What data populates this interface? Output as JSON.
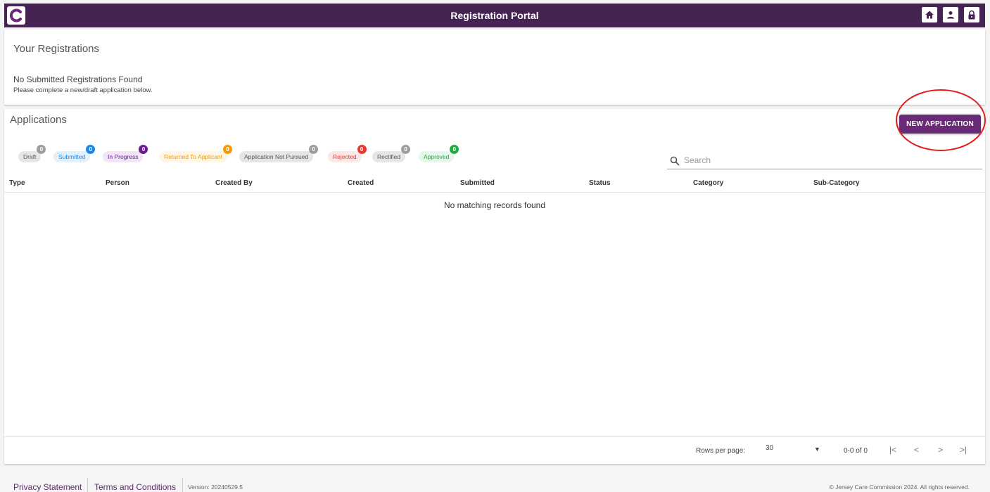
{
  "app": {
    "title": "Registration Portal",
    "brand_color": "#452353",
    "accent_color": "#6b2a78",
    "nav_icons": [
      "home-icon",
      "account-icon",
      "lock-icon"
    ]
  },
  "registrations": {
    "title": "Your Registrations",
    "empty_message": "No Submitted Registrations Found",
    "empty_hint": "Please complete a new/draft application below."
  },
  "applications": {
    "title": "Applications",
    "new_button_label": "NEW APPLICATION",
    "filters": [
      {
        "label": "Draft",
        "count": "0",
        "text_color": "#555555",
        "bg": "#e6e6e6",
        "badge": "#9e9e9e"
      },
      {
        "label": "Submitted",
        "count": "0",
        "text_color": "#1e88e5",
        "bg": "#e3f1fd",
        "badge": "#1e88e5"
      },
      {
        "label": "In Progress",
        "count": "0",
        "text_color": "#6a1b9a",
        "bg": "#f1e6f5",
        "badge": "#6a1b9a"
      },
      {
        "label": "Returned To Applicant",
        "count": "0",
        "text_color": "#f59b00",
        "bg": "#fff6e5",
        "badge": "#f59b00"
      },
      {
        "label": "Application Not Pursued",
        "count": "0",
        "text_color": "#555555",
        "bg": "#e6e6e6",
        "badge": "#9e9e9e"
      },
      {
        "label": "Rejected",
        "count": "0",
        "text_color": "#e53935",
        "bg": "#fde7e7",
        "badge": "#e53935"
      },
      {
        "label": "Rectified",
        "count": "0",
        "text_color": "#555555",
        "bg": "#e6e6e6",
        "badge": "#9e9e9e"
      },
      {
        "label": "Approved",
        "count": "0",
        "text_color": "#1fae3d",
        "bg": "#e6f6ea",
        "badge": "#1fae3d"
      }
    ],
    "search_placeholder": "Search",
    "columns": [
      "Type",
      "Person",
      "Created By",
      "Created",
      "Submitted",
      "Status",
      "Category",
      "Sub-Category"
    ],
    "empty_message": "No matching records found",
    "pagination": {
      "rows_per_page_label": "Rows per page:",
      "rows_per_page": "30",
      "range": "0-0 of 0"
    }
  },
  "footer": {
    "privacy": "Privacy Statement",
    "terms": "Terms and Conditions",
    "version": "Version: 20240529.5",
    "copyright": "© Jersey Care Commission 2024. All rights reserved."
  }
}
